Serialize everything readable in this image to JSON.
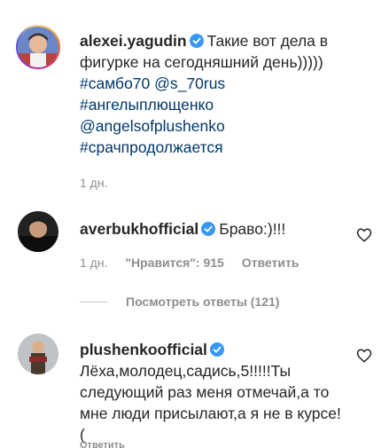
{
  "post": {
    "username": "alexei.yagudin",
    "caption_text": "Такие вот дела в фигурке на сегодняшний день)))))",
    "hashtags": [
      "#самбо70",
      "@s_70rus",
      "#ангелыплющенко",
      "@angelsofplushenko",
      "#срачпродолжается"
    ],
    "time": "1 дн."
  },
  "comments": [
    {
      "username": "averbukhofficial",
      "text": "Браво:)!!!",
      "time": "1 дн.",
      "likes": "\"Нравится\": 915",
      "reply_label": "Ответить",
      "view_replies": "Посмотреть ответы (121)"
    },
    {
      "username": "plushenkoofficial",
      "text": "Лёха,молодец,садись,5!!!!!Ты следующий раз меня отмечай,а то мне люди присылают,а я не в курсе!(",
      "reply_label": "Ответить"
    }
  ],
  "colors": {
    "link": "#00376b",
    "verified": "#3897f0",
    "muted": "#8e8e8e"
  },
  "icons": [
    "verified-icon",
    "heart-icon"
  ]
}
